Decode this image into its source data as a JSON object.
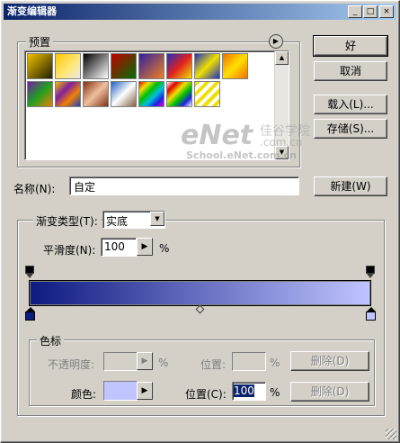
{
  "window": {
    "title": "渐变编辑器"
  },
  "presets": {
    "label": "预置",
    "swatches": [
      {
        "name": "preset-fg-bg",
        "bg": "linear-gradient(135deg,#f0c000,#202000)"
      },
      {
        "name": "preset-fg-transparent",
        "bg": "linear-gradient(135deg,#f8c800,#ffe880 60%,#e8e8e8)"
      },
      {
        "name": "preset-black-white",
        "bg": "linear-gradient(135deg,#000,#fff)"
      },
      {
        "name": "preset-red-green",
        "bg": "linear-gradient(135deg,#c00000,#007000)"
      },
      {
        "name": "preset-violet-orange",
        "bg": "linear-gradient(135deg,#3020a0,#f08020)"
      },
      {
        "name": "preset-blue-red-yellow",
        "bg": "linear-gradient(135deg,#2030c0,#e02020 50%,#f0e000)"
      },
      {
        "name": "preset-blue-yellow-blue",
        "bg": "linear-gradient(135deg,#2030c0,#f0e000 50%,#2030c0)"
      },
      {
        "name": "preset-orange-yellow-orange",
        "bg": "linear-gradient(135deg,#f07000,#ffe000 50%,#f07000)"
      },
      {
        "name": "preset-violet-green-orange",
        "bg": "linear-gradient(135deg,#7020a0,#20a020 50%,#f08000)"
      },
      {
        "name": "preset-yellow-violet-orange-blue",
        "bg": "linear-gradient(135deg,#f0c000,#8020a0 35%,#f08000 65%,#2040c0)"
      },
      {
        "name": "preset-copper",
        "bg": "linear-gradient(135deg,#803010,#f0c0a0 50%,#803010)"
      },
      {
        "name": "preset-chrome",
        "bg": "linear-gradient(135deg,#2060c0,#ffffff 50%,#806040)"
      },
      {
        "name": "preset-spectrum",
        "bg": "linear-gradient(135deg,#e00000,#f0e000,#00c000,#00c0e0,#2020e0,#e000e0)"
      },
      {
        "name": "preset-transparent-rainbow",
        "bg": "linear-gradient(135deg,#ffffff,#e00000,#f0e000,#00c000,#2020e0,#ffffff)"
      },
      {
        "name": "preset-transparent-stripes",
        "bg": "repeating-linear-gradient(135deg,#f0e000 0 4px,#ffffff 4px 8px)"
      }
    ]
  },
  "buttons": {
    "ok": "好",
    "cancel": "取消",
    "load": "载入(L)...",
    "save": "存储(S)...",
    "new": "新建(W)",
    "delete_opacity": "删除(D)",
    "delete_color": "删除(D)"
  },
  "name_field": {
    "label": "名称(N):",
    "value": "自定"
  },
  "gradient_type": {
    "label": "渐变类型(T):",
    "value": "实底"
  },
  "smoothness": {
    "label": "平滑度(N):",
    "value": "100",
    "unit": "%"
  },
  "gradient_bar": {
    "start_color": "#0d1a80",
    "end_color": "#c0c4ff"
  },
  "color_stops": {
    "label": "色标",
    "opacity_label": "不透明度:",
    "opacity_unit": "%",
    "opacity_location_label": "位置:",
    "opacity_location_unit": "%",
    "color_label": "颜色:",
    "color_value": "#c0c4ff",
    "location_label": "位置(C):",
    "location_value": "100",
    "location_unit": "%"
  },
  "watermark": {
    "brand": "eNet",
    "cn": "佳谷学院",
    "site1": ".com.cn",
    "site2": "School.eNet.com.cn"
  }
}
